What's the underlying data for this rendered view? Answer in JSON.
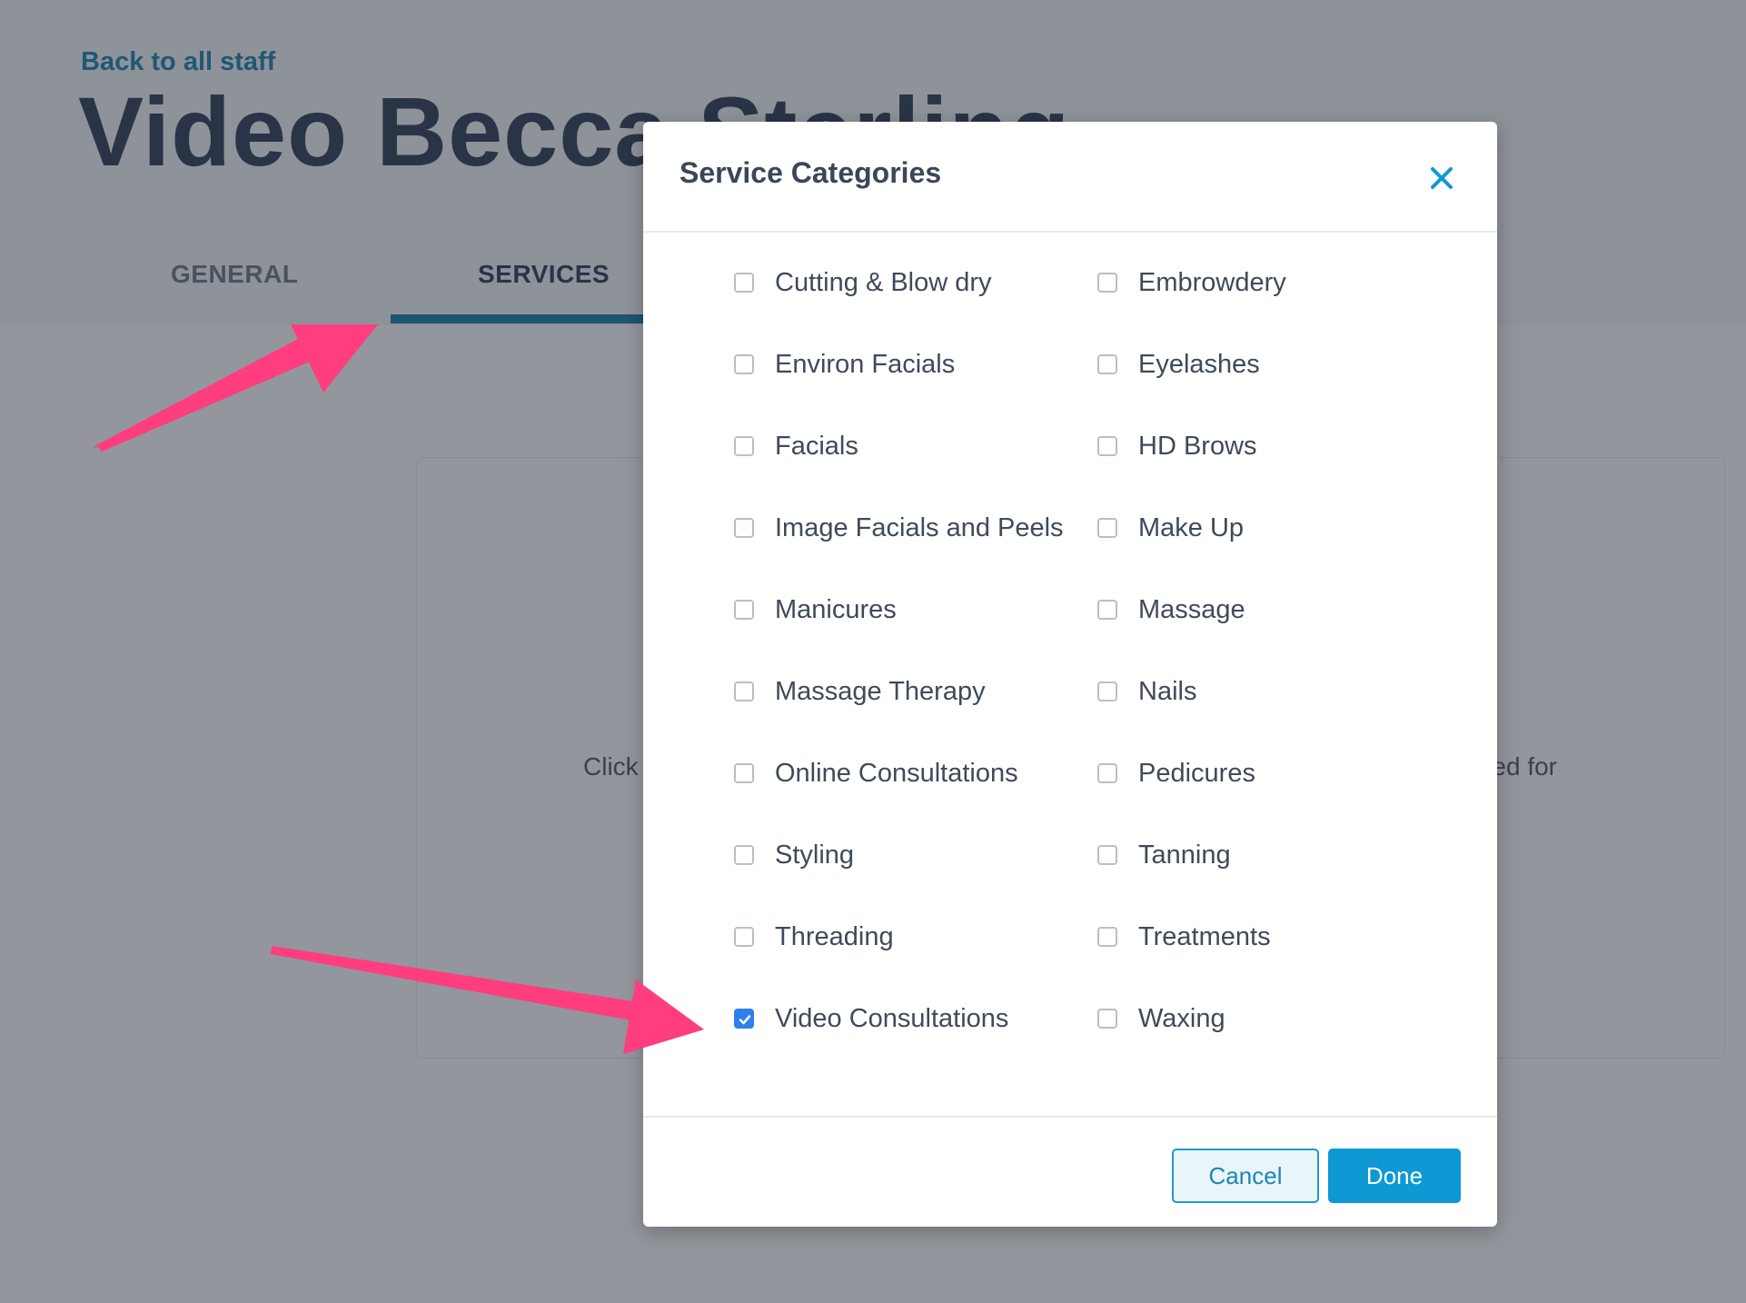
{
  "page": {
    "back_link": "Back to all staff",
    "title": "Video Becca Sterling",
    "tabs": [
      {
        "label": "GENERAL",
        "active": false
      },
      {
        "label": "SERVICES",
        "active": true
      }
    ],
    "card_hint_visible_start": "Click",
    "card_hint_visible_end": "ed for"
  },
  "modal": {
    "title": "Service Categories",
    "close_icon": "close-icon",
    "categories": [
      {
        "label": "Cutting & Blow dry",
        "checked": false
      },
      {
        "label": "Embrowdery",
        "checked": false
      },
      {
        "label": "Environ Facials",
        "checked": false
      },
      {
        "label": "Eyelashes",
        "checked": false
      },
      {
        "label": "Facials",
        "checked": false
      },
      {
        "label": "HD Brows",
        "checked": false
      },
      {
        "label": "Image Facials and Peels",
        "checked": false
      },
      {
        "label": "Make Up",
        "checked": false
      },
      {
        "label": "Manicures",
        "checked": false
      },
      {
        "label": "Massage",
        "checked": false
      },
      {
        "label": "Massage Therapy",
        "checked": false
      },
      {
        "label": "Nails",
        "checked": false
      },
      {
        "label": "Online Consultations",
        "checked": false
      },
      {
        "label": "Pedicures",
        "checked": false
      },
      {
        "label": "Styling",
        "checked": false
      },
      {
        "label": "Tanning",
        "checked": false
      },
      {
        "label": "Threading",
        "checked": false
      },
      {
        "label": "Treatments",
        "checked": false
      },
      {
        "label": "Video Consultations",
        "checked": true
      },
      {
        "label": "Waxing",
        "checked": false
      }
    ],
    "cancel_label": "Cancel",
    "done_label": "Done"
  },
  "colors": {
    "accent": "#0e98d4",
    "link": "#1883ae",
    "checkbox_checked": "#2f80ed",
    "annotation_arrow": "#ff3d7f"
  }
}
